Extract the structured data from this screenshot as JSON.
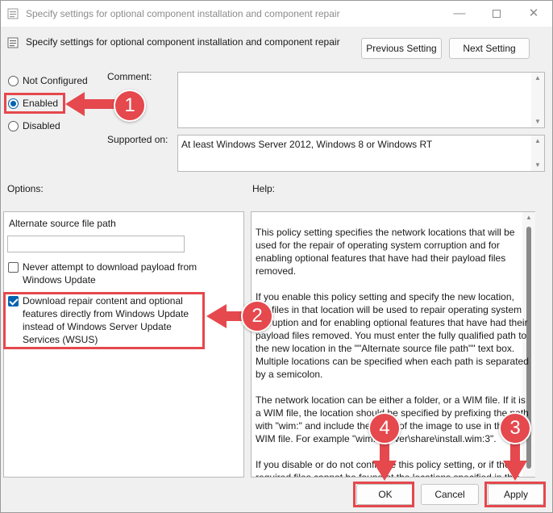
{
  "window": {
    "title": "Specify settings for optional component installation and component repair",
    "minimize_glyph": "—",
    "close_glyph": "✕"
  },
  "header": {
    "title": "Specify settings for optional component installation and component repair",
    "previous_label": "Previous Setting",
    "next_label": "Next Setting"
  },
  "state": {
    "options": [
      {
        "label": "Not Configured",
        "checked": false
      },
      {
        "label": "Enabled",
        "checked": true
      },
      {
        "label": "Disabled",
        "checked": false
      }
    ]
  },
  "comment": {
    "label": "Comment:",
    "value": ""
  },
  "supported": {
    "label": "Supported on:",
    "value": "At least Windows Server 2012, Windows 8 or Windows RT"
  },
  "options_panel": {
    "label": "Options:",
    "alt_source_label": "Alternate source file path",
    "alt_source_value": "",
    "never_download": {
      "label": "Never attempt to download payload from Windows Update",
      "checked": false
    },
    "download_repair": {
      "label": "Download repair content and optional features directly from Windows Update instead of Windows Server Update Services (WSUS)",
      "checked": true
    }
  },
  "help": {
    "label": "Help:",
    "paragraphs": [
      "This policy setting specifies the network locations that will be used for the repair of operating system corruption and for enabling optional features that have had their payload files removed.",
      "If you enable this policy setting and specify the new location, the files in that location will be used to repair operating system corruption and for enabling optional features that have had their payload files removed. You must enter the fully qualified path to the new location in the \"\"Alternate source file path\"\" text box. Multiple locations can be specified when each path is separated by a semicolon.",
      "The network location can be either a folder, or a WIM file. If it is a WIM file, the location should be specified by prefixing the path with \"wim:\" and include the index of the image to use in the WIM file. For example \"wim:\\\\server\\share\\install.wim:3\".",
      "If you disable or do not configure this policy setting, or if the required files cannot be found at the locations specified in this policy setting, the files will be downloaded from Windows Update."
    ]
  },
  "footer": {
    "ok_label": "OK",
    "cancel_label": "Cancel",
    "apply_label": "Apply"
  },
  "annotations": {
    "accent": "#e5484d",
    "steps": [
      "1",
      "2",
      "3",
      "4"
    ]
  },
  "icons": {
    "window": "policy-icon",
    "header": "policy-icon"
  }
}
